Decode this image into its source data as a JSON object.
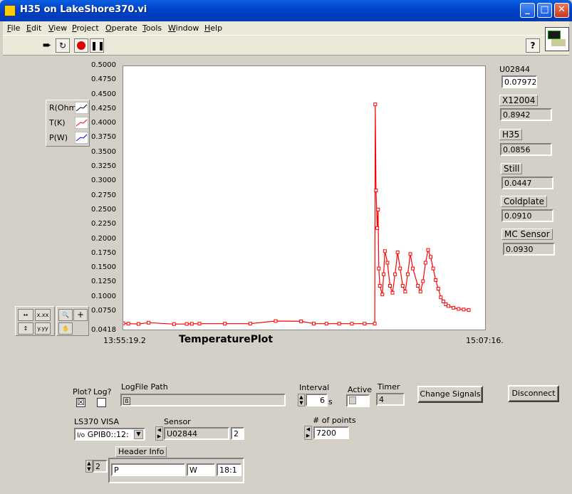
{
  "window": {
    "title": "H35 on LakeShore370.vi"
  },
  "menu": [
    "File",
    "Edit",
    "View",
    "Project",
    "Operate",
    "Tools",
    "Window",
    "Help"
  ],
  "graph": {
    "title": "TemperaturePlot",
    "x_start": "13:55:19.2",
    "x_end": "15:07:16.",
    "y_ticks": [
      "0.5000",
      "0.4750",
      "0.4500",
      "0.4250",
      "0.4000",
      "0.3750",
      "0.3500",
      "0.3250",
      "0.3000",
      "0.2750",
      "0.2500",
      "0.2250",
      "0.2000",
      "0.1750",
      "0.1500",
      "0.1250",
      "0.1000",
      "0.0750",
      "0.0418"
    ],
    "legend": [
      "R(Ohm)",
      "T(K)",
      "P(W)"
    ],
    "trace_color": "#ff0000"
  },
  "chart_data": {
    "type": "line",
    "title": "TemperaturePlot",
    "xlabel": "",
    "ylabel": "",
    "xlim": [
      "13:55:19.2",
      "15:07:16."
    ],
    "ylim": [
      0.0418,
      0.5
    ],
    "series": [
      {
        "name": "T(K)",
        "color": "#ff0000",
        "x": [
          0,
          0.02,
          0.06,
          0.1,
          0.2,
          0.25,
          0.27,
          0.3,
          0.4,
          0.5,
          0.6,
          0.7,
          0.75,
          0.8,
          0.85,
          0.9,
          0.95,
          0.99,
          0.992,
          0.995,
          1.0,
          1.003,
          1.006,
          1.01,
          1.02,
          1.025,
          1.03,
          1.04,
          1.05,
          1.06,
          1.07,
          1.08,
          1.09,
          1.1,
          1.11,
          1.12,
          1.13,
          1.14,
          1.16,
          1.17,
          1.18,
          1.19,
          1.2,
          1.21,
          1.22,
          1.23,
          1.24,
          1.25,
          1.26,
          1.27,
          1.28,
          1.3,
          1.32,
          1.34,
          1.36
        ],
        "values": [
          0.0552,
          0.0545,
          0.054,
          0.0562,
          0.0538,
          0.054,
          0.0542,
          0.0545,
          0.0545,
          0.0545,
          0.059,
          0.0585,
          0.0545,
          0.0545,
          0.0545,
          0.0545,
          0.0545,
          0.0545,
          0.434,
          0.285,
          0.22,
          0.252,
          0.15,
          0.12,
          0.105,
          0.14,
          0.18,
          0.16,
          0.12,
          0.108,
          0.14,
          0.178,
          0.15,
          0.12,
          0.11,
          0.14,
          0.175,
          0.15,
          0.12,
          0.11,
          0.128,
          0.16,
          0.182,
          0.17,
          0.15,
          0.13,
          0.115,
          0.1,
          0.093,
          0.088,
          0.085,
          0.082,
          0.08,
          0.079,
          0.078
        ]
      }
    ]
  },
  "sensors": [
    {
      "name": "U02844",
      "value": "0.07972"
    },
    {
      "name": "X12004",
      "value": "0.8942"
    },
    {
      "name": "H35",
      "value": "0.0856"
    },
    {
      "name": "Still",
      "value": "0.0447"
    },
    {
      "name": "Coldplate",
      "value": "0.0910"
    },
    {
      "name": "MC Sensor",
      "value": "0.0930"
    }
  ],
  "controls": {
    "plot_label": "Plot?",
    "log_label": "Log?",
    "plot_checked": "☒",
    "logfile_label": "LogFile Path",
    "logfile_value": "",
    "interval_label": "Interval",
    "interval_value": "6",
    "interval_unit": "s",
    "active_label": "Active",
    "timer_label": "Timer",
    "timer_value": "4",
    "change_signals": "Change Signals",
    "disconnect": "Disconnect",
    "visa_label": "LS370 VISA",
    "visa_value": "GPIB0::12:",
    "sensor_label": "Sensor",
    "sensor_value": "U02844",
    "sensor_index": "2",
    "points_label": "# of points",
    "points_value": "7200",
    "header_label": "Header Info",
    "header_index": "2",
    "header_p": "P",
    "header_w": "W",
    "header_time": "18:1"
  }
}
